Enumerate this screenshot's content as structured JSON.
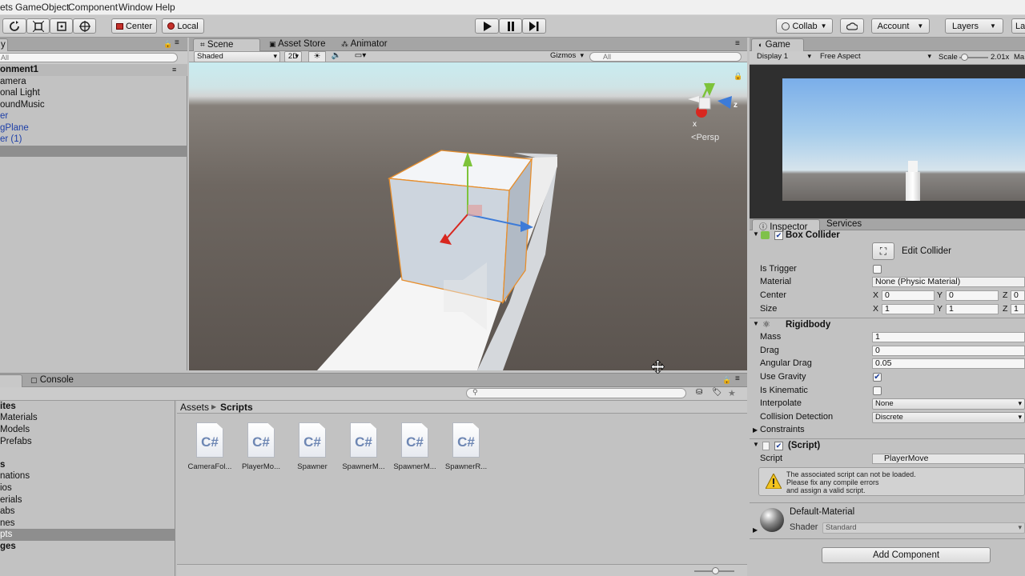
{
  "menu": {
    "assets": "ets",
    "gameobject": "GameObject",
    "component": "Component",
    "window": "Window",
    "help": "Help"
  },
  "toolbar": {
    "center": "Center",
    "local": "Local",
    "collab": "Collab",
    "account": "Account",
    "layers": "Layers",
    "layout": "La"
  },
  "hierarchy": {
    "search_placeholder": "All",
    "scene_name": "onment1",
    "items": [
      "amera",
      "onal Light",
      "oundMusic",
      "er",
      "gPlane",
      "er (1)"
    ]
  },
  "scene": {
    "tab_scene": "Scene",
    "tab_asset_store": "Asset Store",
    "tab_animator": "Animator",
    "shading": "Shaded",
    "mode_2d": "2D",
    "gizmos": "Gizmos",
    "search_placeholder": "All",
    "persp": "Persp",
    "axis_x": "x",
    "axis_z": "z"
  },
  "game": {
    "tab": "Game",
    "display": "Display 1",
    "aspect": "Free Aspect",
    "scale_label": "Scale",
    "scale_value": "2.01x",
    "maximize": "Ma"
  },
  "inspector": {
    "tab_inspector": "Inspector",
    "tab_services": "Services",
    "box_collider": {
      "title": "Box Collider",
      "edit_collider": "Edit Collider",
      "is_trigger_label": "Is Trigger",
      "material_label": "Material",
      "material_value": "None (Physic Material)",
      "center_label": "Center",
      "size_label": "Size",
      "center": {
        "x": "0",
        "y": "0",
        "z": "0"
      },
      "size": {
        "x": "1",
        "y": "1",
        "z": "1"
      },
      "axis_x": "X",
      "axis_y": "Y",
      "axis_z": "Z"
    },
    "rigidbody": {
      "title": "Rigidbody",
      "mass_label": "Mass",
      "mass": "1",
      "drag_label": "Drag",
      "drag": "0",
      "angular_drag_label": "Angular Drag",
      "angular_drag": "0.05",
      "use_gravity_label": "Use Gravity",
      "is_kinematic_label": "Is Kinematic",
      "interpolate_label": "Interpolate",
      "interpolate": "None",
      "collision_label": "Collision Detection",
      "collision": "Discrete",
      "constraints_label": "Constraints"
    },
    "script": {
      "title": "(Script)",
      "script_label": "Script",
      "script_value": "PlayerMove",
      "warning_1": "The associated script can not be loaded.",
      "warning_2": "Please fix any compile errors",
      "warning_3": "and assign a valid script."
    },
    "material": {
      "name": "Default-Material",
      "shader_label": "Shader",
      "shader_value": "Standard"
    },
    "add_component": "Add Component"
  },
  "console": {
    "tab": "Console"
  },
  "project": {
    "folders": [
      "ites",
      "Materials",
      "Models",
      "Prefabs",
      "s",
      "nations",
      "ios",
      "erials",
      "abs",
      "nes",
      "pts",
      "ges"
    ],
    "breadcrumb_root": "Assets",
    "breadcrumb_current": "Scripts",
    "files": [
      {
        "icon": "C#",
        "name": "CameraFol..."
      },
      {
        "icon": "C#",
        "name": "PlayerMo..."
      },
      {
        "icon": "C#",
        "name": "Spawner"
      },
      {
        "icon": "C#",
        "name": "SpawnerM..."
      },
      {
        "icon": "C#",
        "name": "SpawnerM..."
      },
      {
        "icon": "C#",
        "name": "SpawnerR..."
      }
    ]
  }
}
